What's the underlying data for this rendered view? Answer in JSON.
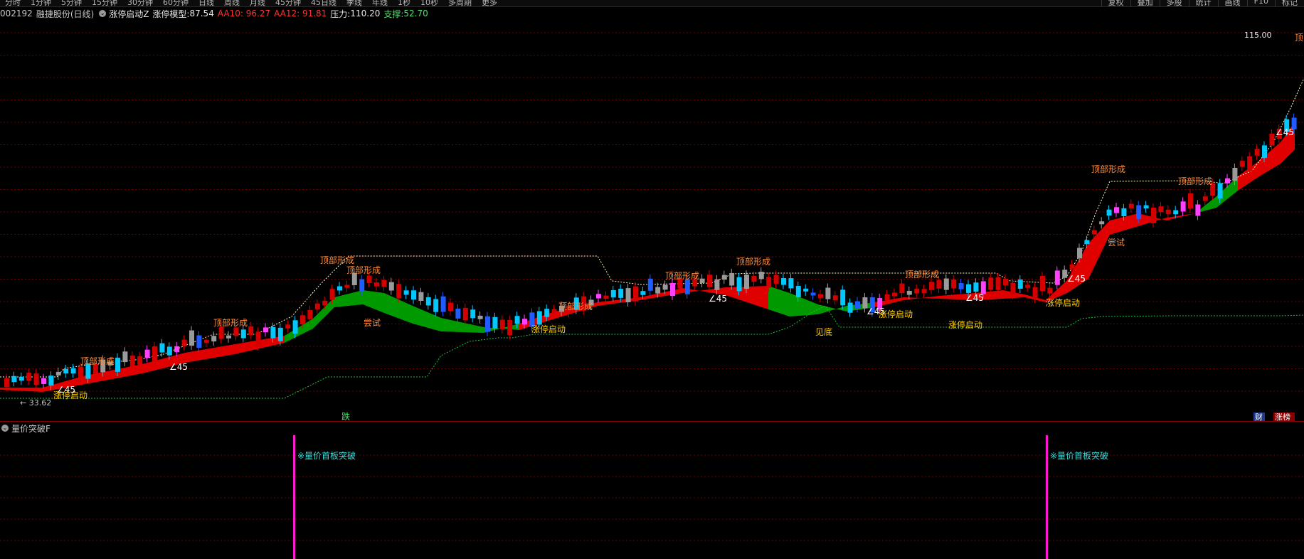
{
  "topbar": {
    "period_tabs": [
      "分时",
      "1分钟",
      "5分钟",
      "15分钟",
      "30分钟",
      "60分钟",
      "日线",
      "周线",
      "月线",
      "45分钟",
      "45日线",
      "季线",
      "年线",
      "1秒",
      "10秒",
      "多周期",
      "更多"
    ],
    "tools": [
      "复权",
      "叠加",
      "多股",
      "统计",
      "画线",
      "F10",
      "标记"
    ]
  },
  "main_header": {
    "code": "002192",
    "name": "融捷股份(日线)",
    "indicator_name": "涨停启动Z",
    "model_label": "涨停模型:",
    "model_value": "87.54",
    "aa10": "AA10: 96.27",
    "aa12": "AA12: 91.81",
    "pressure_label": "压力:",
    "pressure_value": "110.20",
    "support_label": "支撑:",
    "support_value": "52.70"
  },
  "sub_header": {
    "title": "量价突破F"
  },
  "icons": {
    "indicator_toggle": "chevron-down-circle-icon",
    "sub_indicator_toggle": "chevron-down-circle-icon"
  },
  "colors": {
    "up": "#d40000",
    "down_cyan": "#00c8ff",
    "down_blue": "#1e5cff",
    "magenta": "#ff40ff",
    "grey_candle": "#9a9a9a",
    "band_red": "#e00000",
    "band_green": "#009a00",
    "label_orange": "#ff8c3a",
    "label_yellow": "#ffd000",
    "pressure_line": "#ffffc8",
    "support_line": "#20c040",
    "grid": "#6a0000",
    "volume_pink": "#ff1ad0"
  },
  "chart_data": {
    "type": "candlestick",
    "symbol": "002192",
    "price_labels": {
      "max": "115.00",
      "min": "33.62"
    },
    "annotations": {
      "top_formed": "顶部形成",
      "limit_up_start": "涨停启动",
      "try": "尝试",
      "angle": "∠45",
      "bottom": "见底",
      "drop": "跌",
      "top_short": "顶",
      "fin": "财",
      "limit_up_tag": "涨榜"
    },
    "sub_panel": {
      "label": "※量价首板突破"
    }
  }
}
